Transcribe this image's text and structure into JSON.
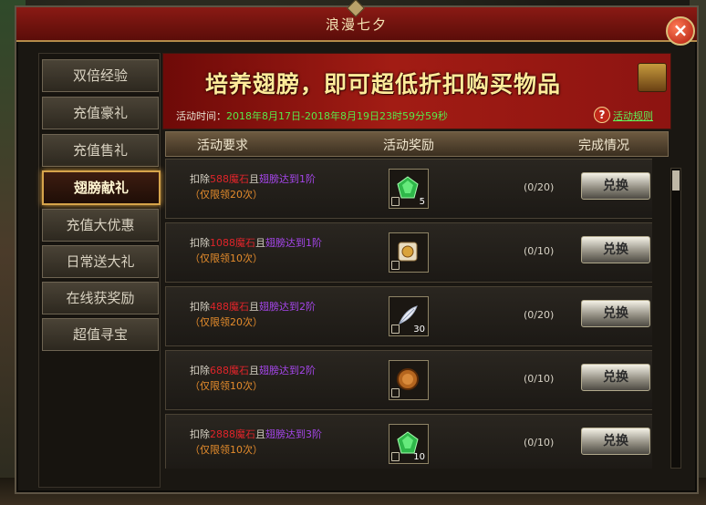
{
  "window": {
    "title": "浪漫七夕",
    "close_label": "×"
  },
  "sidebar": {
    "items": [
      {
        "label": "双倍经验"
      },
      {
        "label": "充值豪礼"
      },
      {
        "label": "充值售礼"
      },
      {
        "label": "翅膀献礼",
        "active": true
      },
      {
        "label": "充值大优惠"
      },
      {
        "label": "日常送大礼"
      },
      {
        "label": "在线获奖励"
      },
      {
        "label": "超值寻宝"
      }
    ]
  },
  "banner": {
    "headline": "培养翅膀，即可超低折扣购买物品",
    "time_prefix": "活动时间：",
    "time_value": "2018年8月17日-2018年8月19日23时59分59秒",
    "help_icon": "?",
    "rules_link": "活动规则"
  },
  "table": {
    "headers": [
      "活动要求",
      "活动奖励",
      "完成情况"
    ],
    "rows": [
      {
        "cost_prefix": "扣除",
        "cost": "588",
        "cost_unit": "魔石",
        "cond_prefix": "且",
        "cond": "翅膀达到1阶",
        "limit": "（仅限领20次）",
        "item_count": "5",
        "progress": "(0/20)",
        "button": "兑换"
      },
      {
        "cost_prefix": "扣除",
        "cost": "1088",
        "cost_unit": "魔石",
        "cond_prefix": "且",
        "cond": "翅膀达到1阶",
        "limit": "（仅限领10次）",
        "item_count": "",
        "progress": "(0/10)",
        "button": "兑换"
      },
      {
        "cost_prefix": "扣除",
        "cost": "488",
        "cost_unit": "魔石",
        "cond_prefix": "且",
        "cond": "翅膀达到2阶",
        "limit": "（仅限领20次）",
        "item_count": "30",
        "progress": "(0/20)",
        "button": "兑换"
      },
      {
        "cost_prefix": "扣除",
        "cost": "688",
        "cost_unit": "魔石",
        "cond_prefix": "且",
        "cond": "翅膀达到2阶",
        "limit": "（仅限领10次）",
        "item_count": "",
        "progress": "(0/10)",
        "button": "兑换"
      },
      {
        "cost_prefix": "扣除",
        "cost": "2888",
        "cost_unit": "魔石",
        "cond_prefix": "且",
        "cond": "翅膀达到3阶",
        "limit": "（仅限领10次）",
        "item_count": "10",
        "progress": "(0/10)",
        "button": "兑换"
      }
    ]
  },
  "colors": {
    "accent_red": "#8a1a14",
    "gold": "#d6a44b",
    "cost_red": "#e0242a",
    "cond_purple": "#a446e9",
    "limit_orange": "#e58c2c",
    "time_green": "#58e84a"
  },
  "icons": {
    "items": [
      "green-gem-icon",
      "scroll-coin-icon",
      "feather-icon",
      "bronze-coin-icon",
      "green-gem-icon"
    ]
  }
}
